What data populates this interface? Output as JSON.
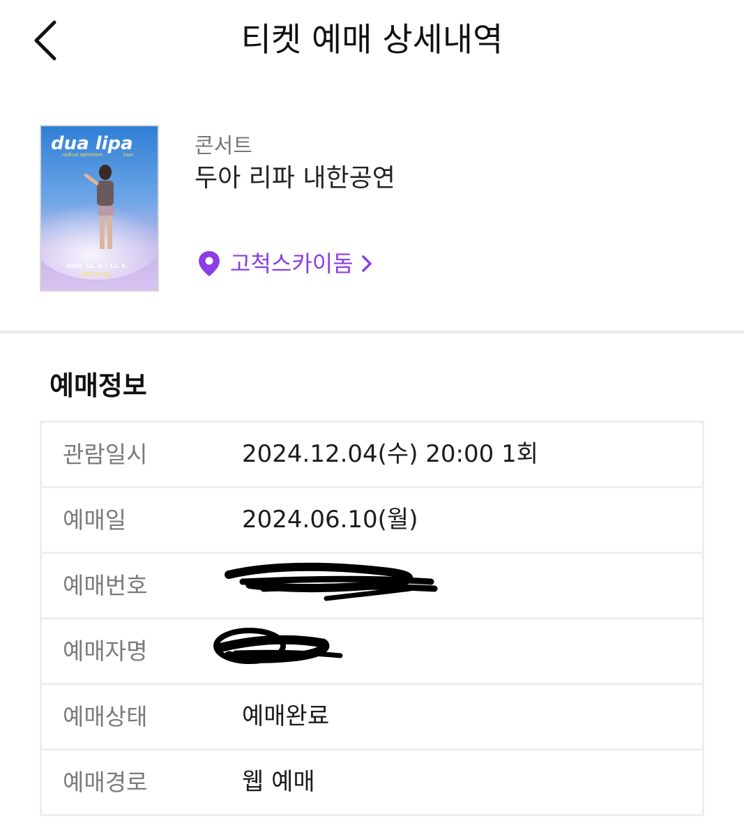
{
  "header": {
    "title": "티켓 예매 상세내역",
    "back_icon": "chevron-left-icon"
  },
  "event": {
    "category": "콘서트",
    "name": "두아 리파 내한공연",
    "venue": "고척스카이돔",
    "venue_icon": "location-pin-icon",
    "venue_chevron_icon": "chevron-right-icon",
    "accent_color": "#8b3ee6",
    "poster": {
      "title": "dua lipa",
      "subtitle": "radical optimism",
      "tour": "tour",
      "dates": "2024. 12. 4. | 12. 5.",
      "venue": "고척스카이돔"
    }
  },
  "booking": {
    "section_title": "예매정보",
    "rows": [
      {
        "label": "관람일시",
        "value": "2024.12.04(수) 20:00 1회"
      },
      {
        "label": "예매일",
        "value": "2024.06.10(월)"
      },
      {
        "label": "예매번호",
        "value": ""
      },
      {
        "label": "예매자명",
        "value": ""
      },
      {
        "label": "예매상태",
        "value": "예매완료"
      },
      {
        "label": "예매경로",
        "value": "웹 예매"
      }
    ]
  }
}
